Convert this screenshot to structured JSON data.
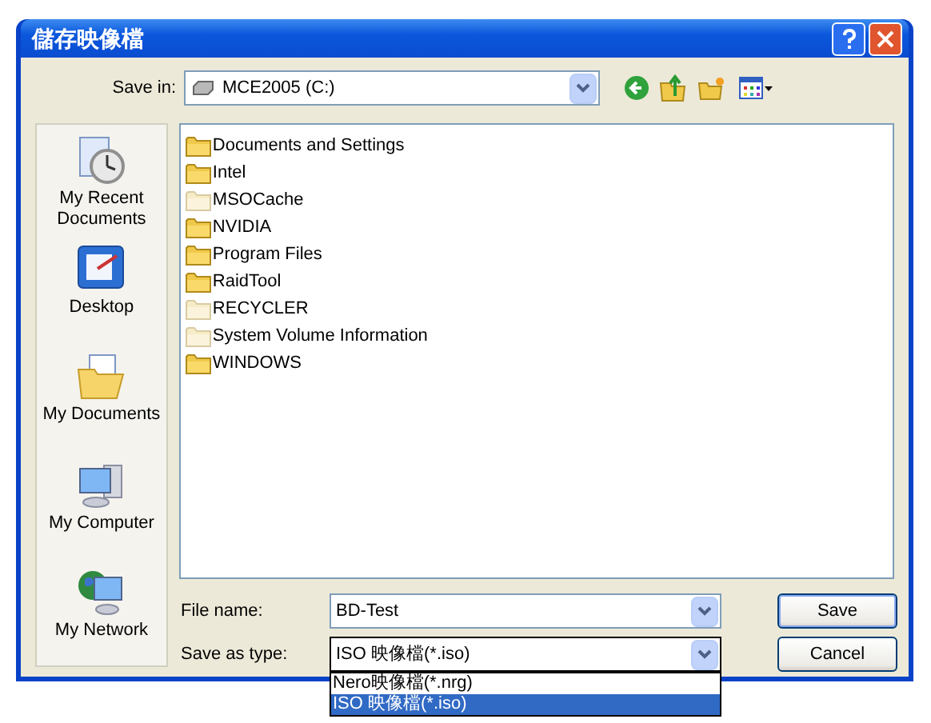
{
  "window": {
    "title": "儲存映像檔"
  },
  "save_in": {
    "label": "Save in:",
    "value": "MCE2005 (C:)"
  },
  "places": [
    {
      "kind": "recent",
      "label": "My Recent Documents"
    },
    {
      "kind": "desktop",
      "label": "Desktop"
    },
    {
      "kind": "documents",
      "label": "My Documents"
    },
    {
      "kind": "computer",
      "label": "My Computer"
    },
    {
      "kind": "network",
      "label": "My Network"
    }
  ],
  "files": [
    {
      "name": "Documents and Settings",
      "hidden": false
    },
    {
      "name": "Intel",
      "hidden": false
    },
    {
      "name": "MSOCache",
      "hidden": true
    },
    {
      "name": "NVIDIA",
      "hidden": false
    },
    {
      "name": "Program Files",
      "hidden": false
    },
    {
      "name": "RaidTool",
      "hidden": false
    },
    {
      "name": "RECYCLER",
      "hidden": true
    },
    {
      "name": "System Volume Information",
      "hidden": true
    },
    {
      "name": "WINDOWS",
      "hidden": false
    }
  ],
  "file_name": {
    "label": "File name:",
    "value": "BD-Test"
  },
  "save_as_type": {
    "label": "Save as type:",
    "value": "ISO 映像檔(*.iso)",
    "expanded": true,
    "options": [
      {
        "label": "Nero映像檔(*.nrg)",
        "selected": false
      },
      {
        "label": "ISO 映像檔(*.iso)",
        "selected": true
      }
    ]
  },
  "buttons": [
    {
      "label": "Save",
      "default": true
    },
    {
      "label": "Cancel",
      "default": false
    }
  ]
}
